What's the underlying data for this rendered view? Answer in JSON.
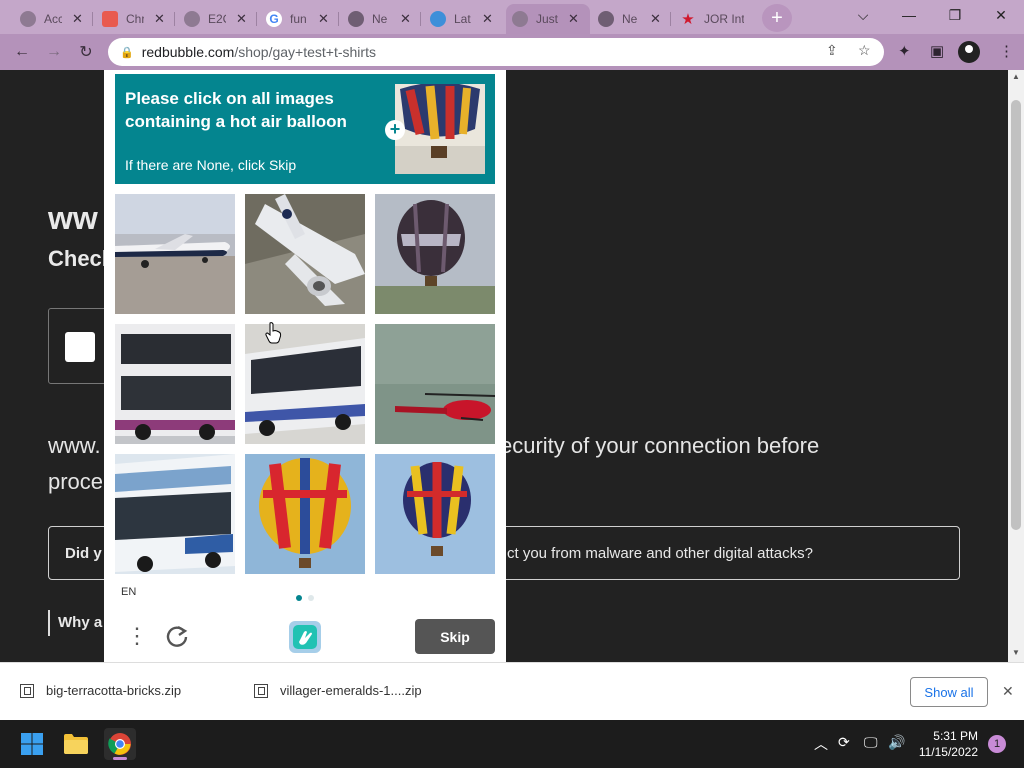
{
  "browser": {
    "tabs": [
      {
        "title": "Acc",
        "favicon": "globe-icon"
      },
      {
        "title": "Chr",
        "favicon": "chrome-store-icon"
      },
      {
        "title": "E2C",
        "favicon": "globe-icon"
      },
      {
        "title": "fun",
        "favicon": "google-icon"
      },
      {
        "title": "Ne",
        "favicon": "globe-icon"
      },
      {
        "title": "Lat",
        "favicon": "earth-icon"
      },
      {
        "title": "Just",
        "favicon": "globe-icon"
      },
      {
        "title": "Ne",
        "favicon": "globe-icon"
      },
      {
        "title": "JOR Int",
        "favicon": "star-icon"
      }
    ],
    "active_tab_index": 6,
    "url_domain": "redbubble.com",
    "url_path": "/shop/gay+test+t-shirts",
    "accent": "#b492ba"
  },
  "page": {
    "heading": "ww",
    "subheading": "Check",
    "body_line1_left": "www.",
    "body_line1_right": "ecurity of your connection before",
    "body_line2": "proce",
    "card_left": "Did y",
    "card_right": "ct you from malware and other digital attacks?",
    "why": "Why a"
  },
  "captcha": {
    "prompt": "Please click on all images containing a hot air balloon",
    "hint": "If there are None, click Skip",
    "header_color": "#04858f",
    "tiles": [
      {
        "subject": "airplane"
      },
      {
        "subject": "airplane"
      },
      {
        "subject": "hot air balloon"
      },
      {
        "subject": "bus"
      },
      {
        "subject": "bus"
      },
      {
        "subject": "helicopter"
      },
      {
        "subject": "bus"
      },
      {
        "subject": "hot air balloon"
      },
      {
        "subject": "hot air balloon"
      }
    ],
    "language": "EN",
    "skip_label": "Skip"
  },
  "downloads": {
    "items": [
      "big-terracotta-bricks.zip",
      "villager-emeralds-1....zip"
    ],
    "show_all": "Show all"
  },
  "taskbar": {
    "time": "5:31 PM",
    "date": "11/15/2022",
    "notifications": "1"
  }
}
